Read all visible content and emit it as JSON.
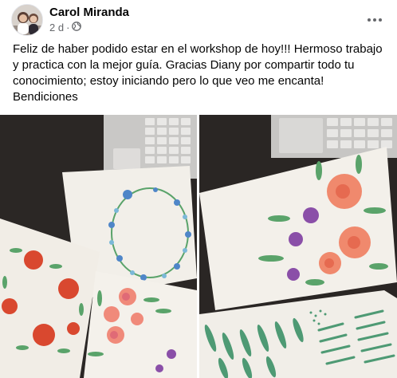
{
  "post": {
    "author": "Carol Miranda",
    "timestamp": "2 d",
    "separator": "·",
    "audience_icon": "globe-icon",
    "more_icon": "more-options-icon",
    "text": "Feliz de haber podido estar en el workshop de hoy!!! Hermoso trabajo y practica con la mejor guía. Gracias Diany por compartir todo tu conocimiento; estoy iniciando pero lo que veo me encanta! Bendiciones"
  },
  "photos": [
    {
      "name": "watercolor-wreaths-photo"
    },
    {
      "name": "watercolor-roses-and-leaves-photo"
    }
  ],
  "colors": {
    "author_text": "#050505",
    "meta_text": "#65676b",
    "paper": "#f3f0ea",
    "table_dark": "#2a2624",
    "flower_red": "#d9482f",
    "flower_pink": "#f08a7a",
    "flower_blue": "#5c8fd0",
    "flower_purple": "#8a4fa8",
    "leaf_green": "#5aa36a"
  }
}
